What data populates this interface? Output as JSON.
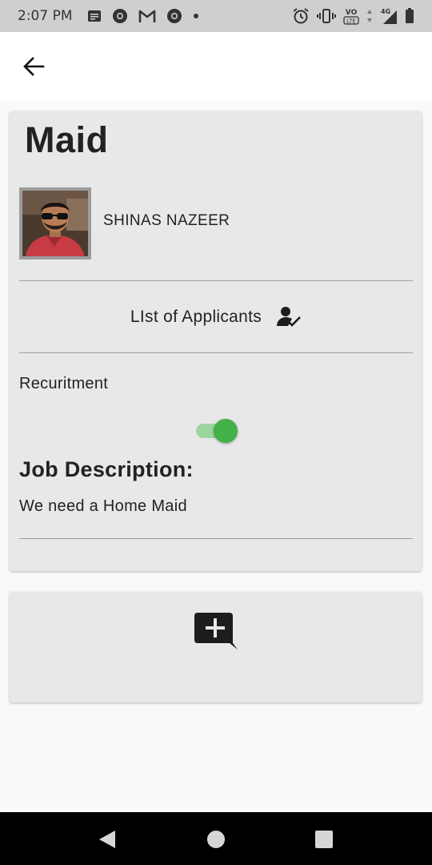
{
  "status_bar": {
    "time": "2:07 PM",
    "left_icons": [
      "message-icon",
      "chrome-icon",
      "gmail-icon",
      "chrome-icon",
      "dot-icon"
    ],
    "right_icons": [
      "alarm-icon",
      "vibrate-icon",
      "volte-icon",
      "data-arrows-icon",
      "signal-4g-icon",
      "battery-icon"
    ],
    "network_label": "4G",
    "volte_label": "VoLTE"
  },
  "app_bar": {
    "back_icon": "arrow-back-icon"
  },
  "job": {
    "title": "Maid",
    "poster_name": "SHINAS NAZEER",
    "applicants_label": "LIst of Applicants",
    "applicants_icon": "person-check-icon",
    "recruitment_label": "Recuritment",
    "recruitment_enabled": true,
    "description_heading": "Job Description:",
    "description_text": "We need a Home Maid"
  },
  "comment_card": {
    "add_icon": "add-comment-icon"
  },
  "nav_bar": {
    "buttons": [
      "back-triangle-icon",
      "home-circle-icon",
      "recents-square-icon"
    ]
  },
  "colors": {
    "card_bg": "#e8e8e8",
    "toggle_track": "#9dd5a0",
    "toggle_thumb": "#43b048",
    "status_bar_bg": "#cfcfcf"
  }
}
